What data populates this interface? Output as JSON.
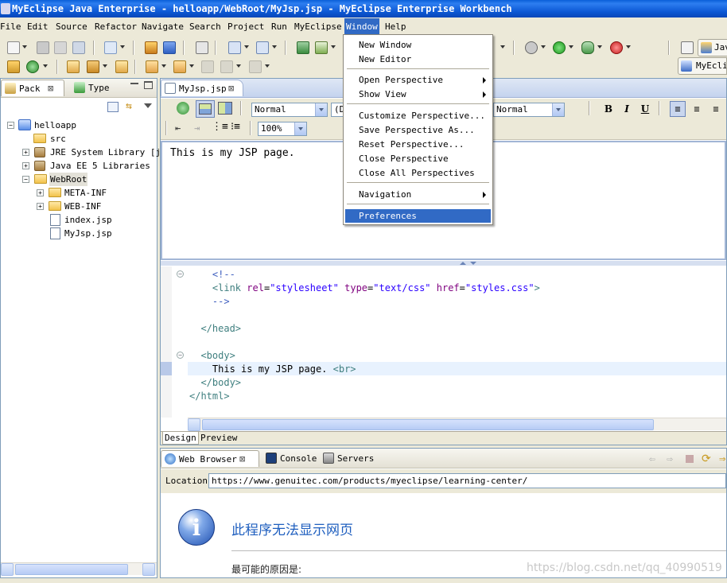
{
  "window": {
    "title": "MyEclipse Java Enterprise - helloapp/WebRoot/MyJsp.jsp - MyEclipse Enterprise Workbench"
  },
  "menubar": {
    "items": [
      {
        "label": "File",
        "active": false
      },
      {
        "label": "Edit",
        "active": false
      },
      {
        "label": "Source",
        "active": false
      },
      {
        "label": "Refactor",
        "active": false
      },
      {
        "label": "Navigate",
        "active": false
      },
      {
        "label": "Search",
        "active": false
      },
      {
        "label": "Project",
        "active": false
      },
      {
        "label": "Run",
        "active": false
      },
      {
        "label": "MyEclipse",
        "active": false
      },
      {
        "label": "Window",
        "active": true
      },
      {
        "label": "Help",
        "active": false
      }
    ]
  },
  "window_menu": {
    "items": [
      {
        "label": "New Window",
        "submenu": false
      },
      {
        "label": "New Editor",
        "submenu": false
      },
      {
        "label": "Open Perspective",
        "submenu": true
      },
      {
        "label": "Show View",
        "submenu": true
      },
      {
        "label": "Customize Perspective...",
        "submenu": false
      },
      {
        "label": "Save Perspective As...",
        "submenu": false
      },
      {
        "label": "Reset Perspective...",
        "submenu": false
      },
      {
        "label": "Close Perspective",
        "submenu": false
      },
      {
        "label": "Close All Perspectives",
        "submenu": false
      },
      {
        "label": "Navigation",
        "submenu": true
      },
      {
        "label": "Preferences",
        "submenu": false,
        "highlighted": true
      }
    ]
  },
  "perspective": {
    "java_label": "Jav",
    "myeclipse_label": "MyEcli"
  },
  "left_panel": {
    "tabs": [
      {
        "label": "Pack",
        "active": true
      },
      {
        "label": "Type",
        "active": false
      }
    ],
    "tree": [
      {
        "label": "helloapp",
        "kind": "project",
        "expanded": true
      },
      {
        "label": "src",
        "kind": "package-folder"
      },
      {
        "label": "JRE System Library [jd",
        "kind": "library"
      },
      {
        "label": "Java EE 5 Libraries",
        "kind": "library"
      },
      {
        "label": "WebRoot",
        "kind": "folder",
        "expanded": true,
        "selected": true
      },
      {
        "label": "META-INF",
        "kind": "folder"
      },
      {
        "label": "WEB-INF",
        "kind": "folder"
      },
      {
        "label": "index.jsp",
        "kind": "jsp"
      },
      {
        "label": "MyJsp.jsp",
        "kind": "jsp"
      }
    ]
  },
  "editor": {
    "tab_label": "MyJsp.jsp",
    "format": {
      "style_select": "Normal",
      "font_select": "(De",
      "size_select": "Normal",
      "zoom_select": "100%",
      "bold": "B",
      "italic": "I",
      "underline": "U"
    },
    "design_text": "This is my JSP page.",
    "code_lines": [
      {
        "indent": "    ",
        "parts": [
          {
            "t": "<!--",
            "c": "cmt"
          }
        ]
      },
      {
        "indent": "    ",
        "parts": [
          {
            "t": "<link ",
            "c": "tag"
          },
          {
            "t": "rel",
            "c": "attr"
          },
          {
            "t": "=",
            "c": ""
          },
          {
            "t": "\"stylesheet\"",
            "c": "val"
          },
          {
            "t": " ",
            "c": ""
          },
          {
            "t": "type",
            "c": "attr"
          },
          {
            "t": "=",
            "c": ""
          },
          {
            "t": "\"text/css\"",
            "c": "val"
          },
          {
            "t": " ",
            "c": ""
          },
          {
            "t": "href",
            "c": "attr"
          },
          {
            "t": "=",
            "c": ""
          },
          {
            "t": "\"styles.css\"",
            "c": "val"
          },
          {
            "t": ">",
            "c": "tag"
          }
        ]
      },
      {
        "indent": "    ",
        "parts": [
          {
            "t": "-->",
            "c": "cmt"
          }
        ]
      },
      {
        "indent": "",
        "parts": []
      },
      {
        "indent": "  ",
        "parts": [
          {
            "t": "</head>",
            "c": "tag"
          }
        ]
      },
      {
        "indent": "",
        "parts": []
      },
      {
        "indent": "  ",
        "parts": [
          {
            "t": "<body>",
            "c": "tag"
          }
        ]
      },
      {
        "indent": "    ",
        "parts": [
          {
            "t": "This is my JSP page. ",
            "c": ""
          },
          {
            "t": "<br>",
            "c": "tag"
          }
        ]
      },
      {
        "indent": "  ",
        "parts": [
          {
            "t": "</body>",
            "c": "tag"
          }
        ]
      },
      {
        "indent": "",
        "parts": [
          {
            "t": "</html>",
            "c": "tag"
          }
        ]
      }
    ],
    "bottom_tabs": [
      {
        "label": "Design",
        "active": true
      },
      {
        "label": "Preview",
        "active": false
      }
    ]
  },
  "bottom_panel": {
    "tabs": [
      {
        "label": "Web Browser",
        "active": true
      },
      {
        "label": "Console",
        "active": false
      },
      {
        "label": "Servers",
        "active": false
      }
    ],
    "location_label": "Location",
    "location_value": "https://www.genuitec.com/products/myeclipse/learning-center/",
    "error_title": "此程序无法显示网页",
    "error_reason": "最可能的原因是:",
    "watermark": "https://blog.csdn.net/qq_40990519"
  },
  "colors": {
    "titlebar": "#0a56d3",
    "menu_highlight": "#316ac5",
    "tag": "#3f7f7f",
    "attr": "#7f007f",
    "value": "#2a00ff",
    "comment": "#3f5fbf"
  }
}
